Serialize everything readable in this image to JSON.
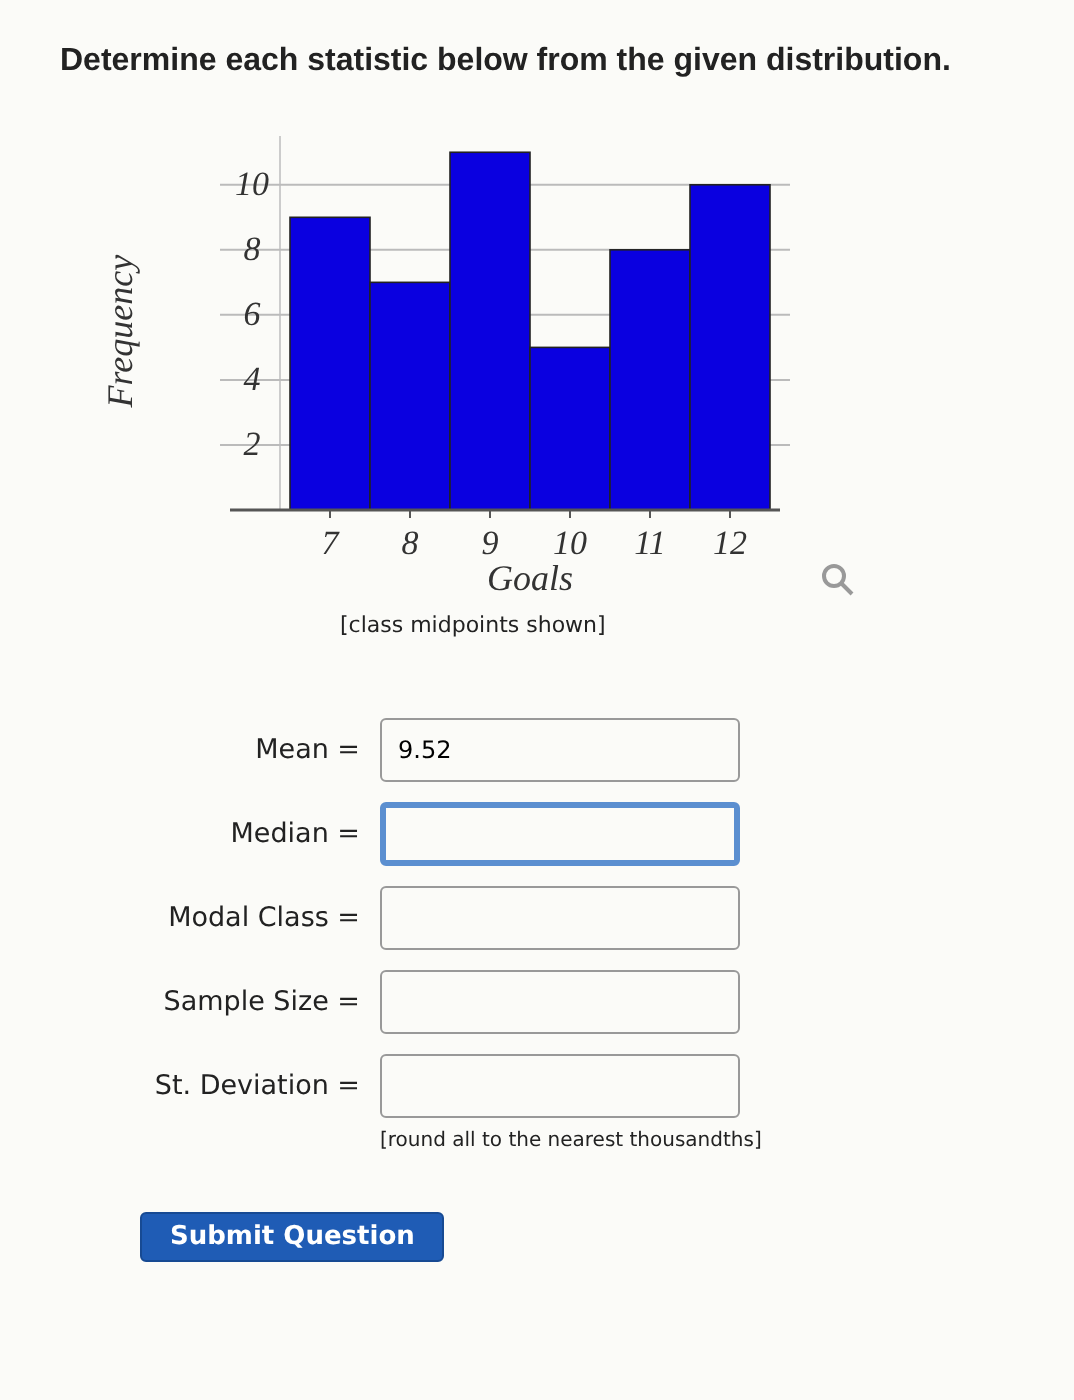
{
  "heading": "Determine each statistic below from the given distribution.",
  "chart": {
    "chart_data": {
      "type": "bar",
      "xlabel": "Goals",
      "ylabel": "Frequency",
      "categories": [
        "7",
        "8",
        "9",
        "10",
        "11",
        "12"
      ],
      "series": [
        {
          "color": "#0a00e0",
          "values": [
            9,
            7,
            11,
            5,
            8,
            10
          ]
        }
      ],
      "ylim": [
        0,
        11.5
      ],
      "yticks": [
        2,
        4,
        6,
        8,
        10
      ],
      "grid": true
    },
    "note": "[class midpoints shown]"
  },
  "fields": [
    {
      "label": "Mean =",
      "value": "9.52",
      "focused": false
    },
    {
      "label": "Median =",
      "focused": true
    },
    {
      "label": "Modal Class =",
      "focused": false
    },
    {
      "label": "Sample Size =",
      "focused": false
    },
    {
      "label": "St. Deviation =",
      "focused": false
    }
  ],
  "hint": "[round all to the nearest thousandths]",
  "submit": "Submit Question"
}
